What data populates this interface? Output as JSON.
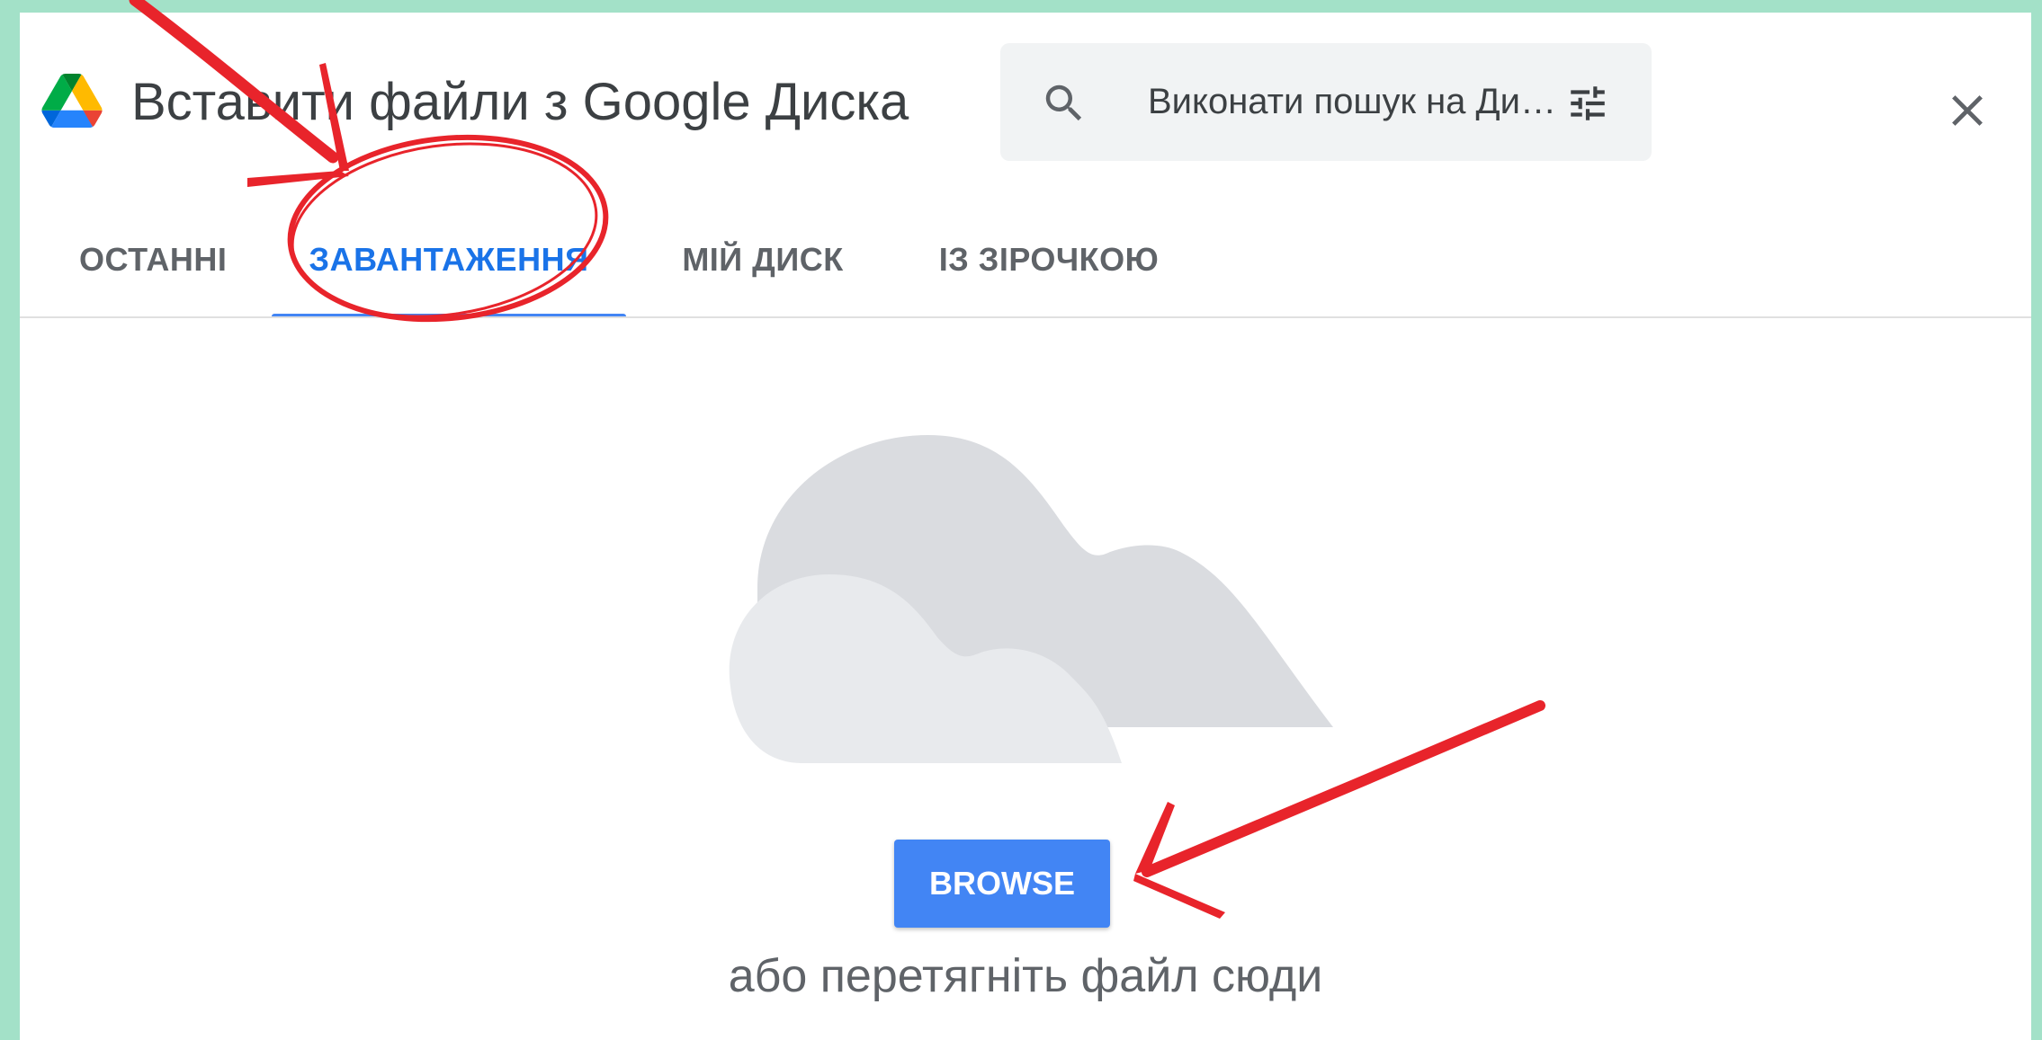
{
  "dialog": {
    "title": "Вставити файли з Google Диска",
    "logo_icon": "google-drive-logo"
  },
  "search": {
    "placeholder": "Виконати пошук на Ди…",
    "icon": "search-icon",
    "filter_icon": "tune-icon"
  },
  "close_icon": "close-icon",
  "tabs": [
    {
      "label": "ОСТАННІ",
      "active": false
    },
    {
      "label": "ЗАВАНТАЖЕННЯ",
      "active": true
    },
    {
      "label": "МІЙ ДИСК",
      "active": false
    },
    {
      "label": "ІЗ ЗІРОЧКОЮ",
      "active": false
    }
  ],
  "upload": {
    "illustration": "cloud-illustration",
    "browse_label": "BROWSE",
    "drop_hint": "або перетягніть файл сюди"
  },
  "colors": {
    "accent": "#4285f4",
    "active_tab_text": "#1a73e8",
    "annotation_red": "#e8242b",
    "frame": "#a3e1c8"
  }
}
